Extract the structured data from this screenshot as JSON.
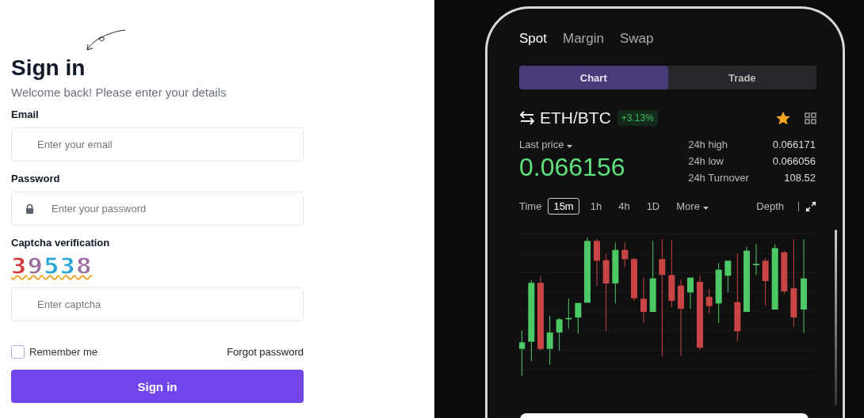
{
  "login": {
    "title": "Sign in",
    "subtitle": "Welcome back! Please enter your details",
    "email": {
      "label": "Email",
      "placeholder": "Enter your email"
    },
    "password": {
      "label": "Password",
      "placeholder": "Enter your password"
    },
    "captcha": {
      "label": "Captcha verification",
      "code": "39538",
      "placeholder": "Enter captcha"
    },
    "remember": {
      "label": "Remember me",
      "checked": false
    },
    "forgot_link": "Forgot password",
    "submit": "Sign in"
  },
  "market": {
    "tabs": [
      {
        "label": "Spot",
        "selected": true
      },
      {
        "label": "Margin",
        "selected": false
      },
      {
        "label": "Swap",
        "selected": false
      }
    ],
    "view_tabs": [
      {
        "label": "Chart",
        "selected": true
      },
      {
        "label": "Trade",
        "selected": false
      }
    ],
    "pair": "ETH/BTC",
    "change": "+3.13%",
    "favorite": true,
    "price_label": "Last price",
    "price": "0.066156",
    "stats": [
      {
        "label": "24h high",
        "value": "0.066171"
      },
      {
        "label": "24h low",
        "value": "0.066056"
      },
      {
        "label": "24h Turnover",
        "value": "108.52"
      }
    ],
    "time_label": "Time",
    "intervals": [
      {
        "label": "15m",
        "selected": true
      },
      {
        "label": "1h",
        "selected": false
      },
      {
        "label": "4h",
        "selected": false
      },
      {
        "label": "1D",
        "selected": false
      }
    ],
    "more": "More",
    "depth": "Depth"
  }
}
